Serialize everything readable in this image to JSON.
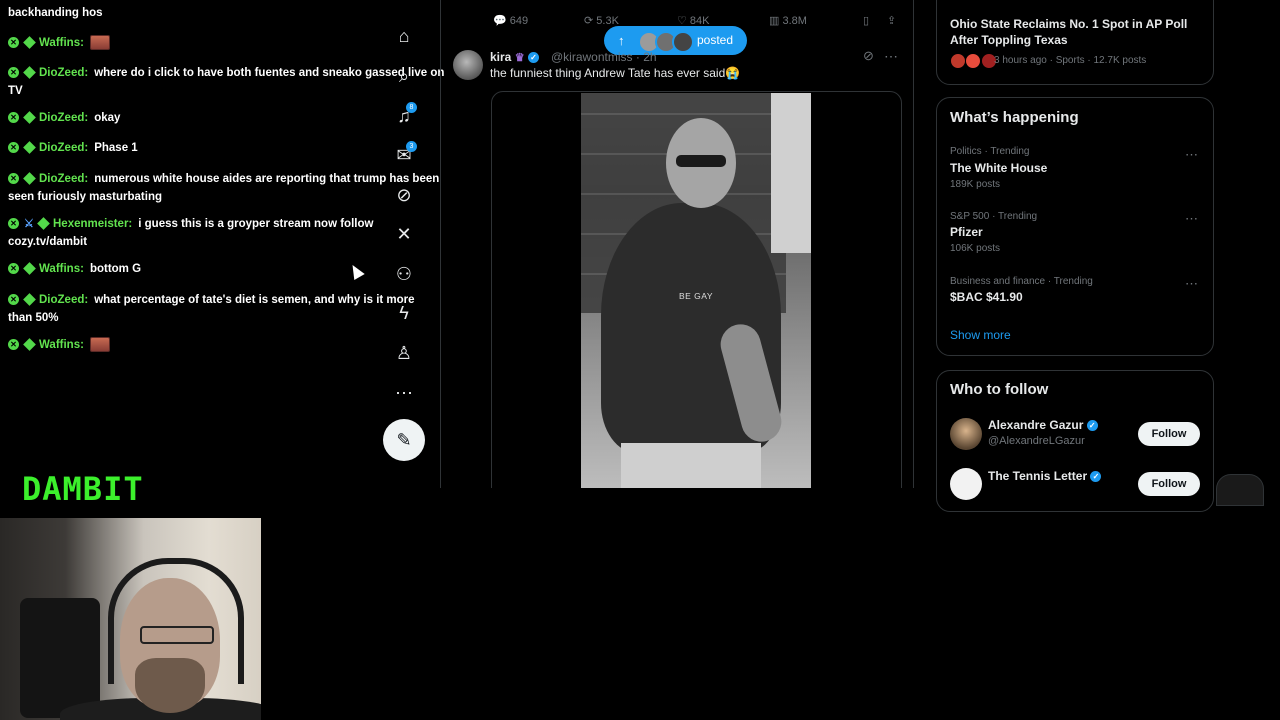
{
  "chat": {
    "first_line_partial": "backhanding hos",
    "messages": [
      {
        "user": "Waffins:",
        "text": ""
      },
      {
        "user": "DioZeed:",
        "text": "where do i click to have both fuentes and sneako gassed live on TV"
      },
      {
        "user": "DioZeed:",
        "text": "okay"
      },
      {
        "user": "DioZeed:",
        "text": "Phase 1"
      },
      {
        "user": "DioZeed:",
        "text": "numerous white house aides are reporting that trump has been seen furiously masturbating"
      },
      {
        "user": "Hexenmeister:",
        "text": "i guess this is a groyper stream now follow cozy.tv/dambit"
      },
      {
        "user": "Waffins:",
        "text": "bottom G"
      },
      {
        "user": "DioZeed:",
        "text": "what percentage of tate's diet is semen, and why is it more than 50%"
      },
      {
        "user": "Waffins:",
        "text": ""
      }
    ]
  },
  "stream_logo": "DAMBIT",
  "nav": {
    "notifications_count": "8",
    "messages_count": "3"
  },
  "feed": {
    "action_bar": {
      "replies": "649",
      "reposts": "5.3K",
      "likes": "84K",
      "views": "3.8M"
    },
    "posted_pill": "posted",
    "tweet": {
      "name": "kira",
      "handle": "@kirawontmiss",
      "time": "· 2h",
      "text": "the funniest thing Andrew Tate has ever said😭",
      "video_caption": "BE GAY"
    }
  },
  "sidebar": {
    "news": {
      "headline": "Ohio State Reclaims No. 1 Spot in AP Poll After Toppling Texas",
      "meta": "3 hours ago · Sports · 12.7K posts"
    },
    "happening": {
      "title": "What’s happening",
      "trends": [
        {
          "category": "Politics · Trending",
          "name": "The White House",
          "count": "189K posts"
        },
        {
          "category": "S&P 500 · Trending",
          "name": "Pfizer",
          "count": "106K posts"
        },
        {
          "category": "Business and finance · Trending",
          "name": "$BAC $41.90",
          "count": ""
        }
      ],
      "show_more": "Show more"
    },
    "who_to_follow": {
      "title": "Who to follow",
      "accounts": [
        {
          "name": "Alexandre Gazur",
          "handle": "@AlexandreLGazur",
          "button": "Follow"
        },
        {
          "name": "The Tennis Letter",
          "handle": "",
          "button": "Follow"
        }
      ]
    }
  }
}
